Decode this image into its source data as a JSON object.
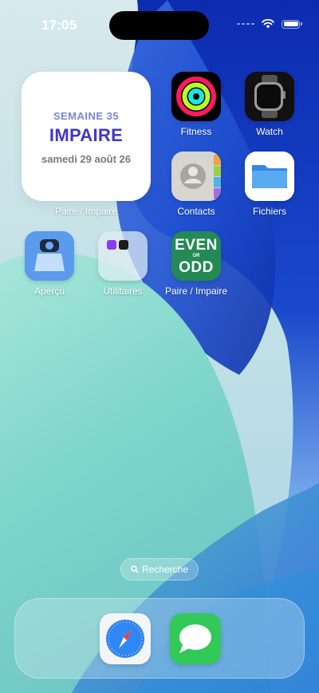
{
  "status_bar": {
    "time": "17:05",
    "signal_icon": "signal-bars-icon",
    "wifi_icon": "wifi-icon",
    "battery_icon": "battery-icon"
  },
  "widget": {
    "week": "SEMAINE 35",
    "parity": "IMPAIRE",
    "date": "samedi 29 août 26",
    "label": "Paire / Impaire",
    "colors": {
      "week": "#7a86e3",
      "parity": "#3f37cf",
      "date": "#7b7b7b"
    }
  },
  "apps": {
    "fitness": "Fitness",
    "watch": "Watch",
    "contacts": "Contacts",
    "files": "Fichiers",
    "preview": "Aperçu",
    "utilities": "Utilitaires",
    "pair_impair": "Paire / Impaire"
  },
  "even_odd_icon": {
    "top": "EVEN",
    "middle": "OR",
    "bottom": "ODD",
    "color": "#238a55"
  },
  "search": {
    "label": "Recherche"
  },
  "dock": [
    {
      "name": "Safari",
      "icon": "safari-icon"
    },
    {
      "name": "Messages",
      "icon": "messages-icon"
    }
  ]
}
